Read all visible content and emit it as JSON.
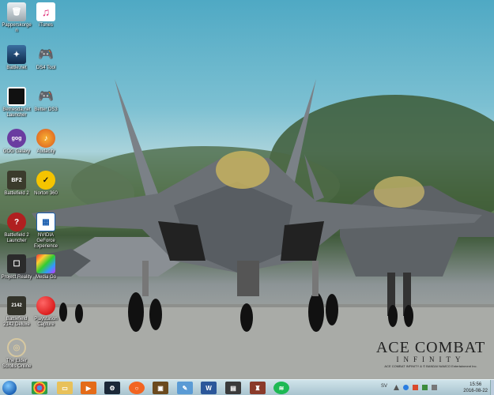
{
  "desktop": {
    "icons": [
      {
        "name": "recycle-bin-icon",
        "label": "Papperskorgen"
      },
      {
        "name": "itunes-icon",
        "label": "iTunes"
      },
      {
        "name": "battlenet-icon",
        "label": "Battle.net"
      },
      {
        "name": "ds4-tool-icon",
        "label": "DS4 Tool"
      },
      {
        "name": "bethesda-launcher-icon",
        "label": "Bethesda.net Launcher"
      },
      {
        "name": "better-ds3-icon",
        "label": "Better DS3"
      },
      {
        "name": "gog-galaxy-icon",
        "label": "GOG Galaxy"
      },
      {
        "name": "audacity-icon",
        "label": "Audacity"
      },
      {
        "name": "battlefield-2-icon",
        "label": "Battlefield 2"
      },
      {
        "name": "norton-360-icon",
        "label": "Norton 360"
      },
      {
        "name": "bf2-launcher-icon",
        "label": "Battlefield 2 Launcher"
      },
      {
        "name": "nvidia-settings-icon",
        "label": "NVIDIA GeForce Experience"
      },
      {
        "name": "project-reality-icon",
        "label": "Project Reality"
      },
      {
        "name": "media-go-icon",
        "label": "Media Go"
      },
      {
        "name": "bf2142-icon",
        "label": "Battlefield 2142 Deluxe"
      },
      {
        "name": "playstation-capture-icon",
        "label": "Playstation Capture"
      },
      {
        "name": "elder-scrolls-online-icon",
        "label": "The Elder Scrolls Online"
      }
    ]
  },
  "wallpaper": {
    "logo_title": "ACE COMBAT",
    "logo_subtitle": "INFINITY",
    "logo_copyright": "ACE COMBAT INFINITY & © BANDAI NAMCO Entertainment Inc."
  },
  "taskbar": {
    "items": [
      "chrome-icon",
      "explorer-icon",
      "media-player-icon",
      "steam-icon",
      "origin-icon",
      "civ-icon",
      "paint-icon",
      "word-icon",
      "taskmanager-icon",
      "game-icon",
      "spotify-icon"
    ],
    "language": "SV",
    "time": "15:56",
    "date": "2016-08-22"
  }
}
